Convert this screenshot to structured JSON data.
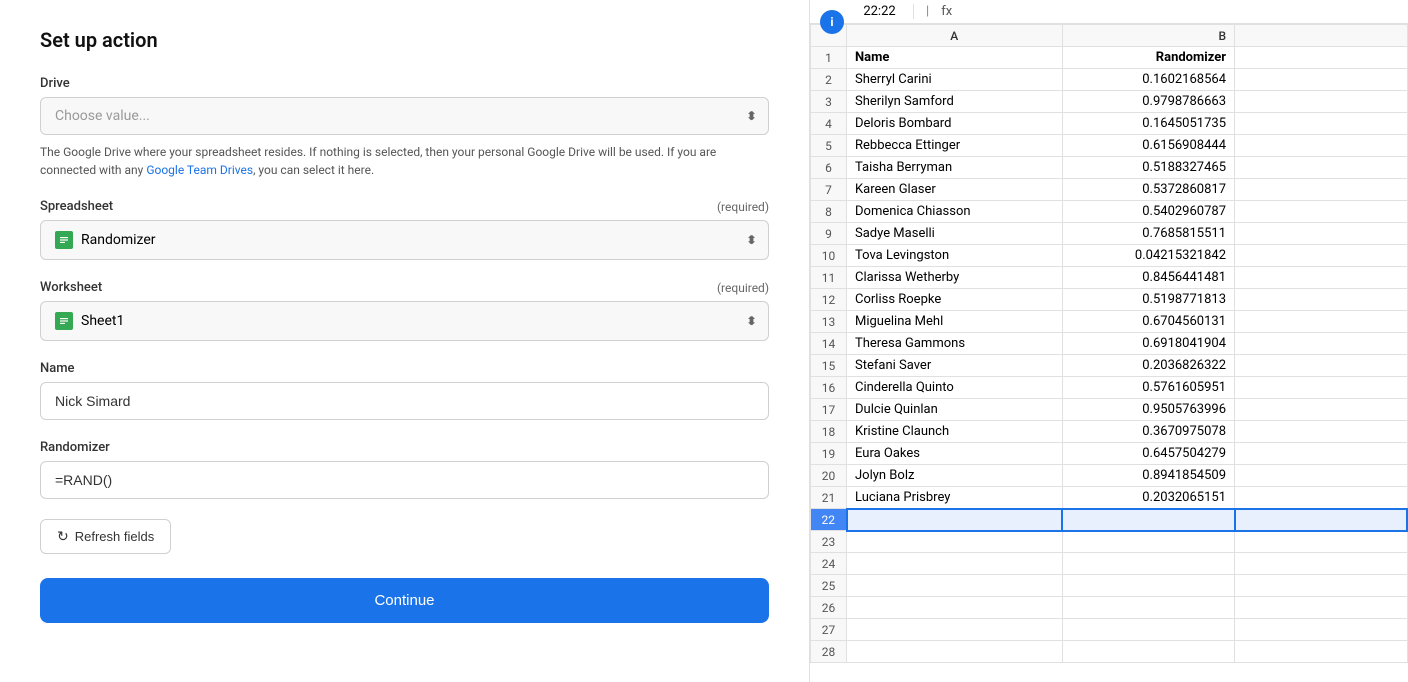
{
  "leftPanel": {
    "title": "Set up action",
    "drive": {
      "label": "Drive",
      "placeholder": "Choose value...",
      "helperText": "The Google Drive where your spreadsheet resides. If nothing is selected, then your personal Google Drive will be used. If you are connected with any ",
      "helperLinkText": "Google Team Drives",
      "helperTextEnd": ", you can select it here."
    },
    "spreadsheet": {
      "label": "Spreadsheet",
      "required": "(required)",
      "value": "Randomizer"
    },
    "worksheet": {
      "label": "Worksheet",
      "required": "(required)",
      "value": "Sheet1"
    },
    "name": {
      "label": "Name",
      "value": "Nick Simard"
    },
    "randomizer": {
      "label": "Randomizer",
      "value": "=RAND()"
    },
    "refreshButton": "Refresh fields",
    "continueButton": "Continue"
  },
  "rightPanel": {
    "formulaBar": {
      "cellRef": "22:22",
      "formula": "fx"
    },
    "columns": [
      "",
      "A",
      "B"
    ],
    "headerRow": {
      "col1": "Name",
      "col2": "Randomizer"
    },
    "rows": [
      {
        "num": 2,
        "name": "Sherryl Carini",
        "value": "0.1602168564"
      },
      {
        "num": 3,
        "name": "Sherilyn Samford",
        "value": "0.9798786663"
      },
      {
        "num": 4,
        "name": "Deloris Bombard",
        "value": "0.1645051735"
      },
      {
        "num": 5,
        "name": "Rebbecca Ettinger",
        "value": "0.6156908444"
      },
      {
        "num": 6,
        "name": "Taisha Berryman",
        "value": "0.5188327465"
      },
      {
        "num": 7,
        "name": "Kareen Glaser",
        "value": "0.5372860817"
      },
      {
        "num": 8,
        "name": "Domenica Chiasson",
        "value": "0.5402960787"
      },
      {
        "num": 9,
        "name": "Sadye Maselli",
        "value": "0.7685815511"
      },
      {
        "num": 10,
        "name": "Tova Levingston",
        "value": "0.04215321842"
      },
      {
        "num": 11,
        "name": "Clarissa Wetherby",
        "value": "0.8456441481"
      },
      {
        "num": 12,
        "name": "Corliss Roepke",
        "value": "0.5198771813"
      },
      {
        "num": 13,
        "name": "Miguelina Mehl",
        "value": "0.6704560131"
      },
      {
        "num": 14,
        "name": "Theresa Gammons",
        "value": "0.6918041904"
      },
      {
        "num": 15,
        "name": "Stefani Saver",
        "value": "0.2036826322"
      },
      {
        "num": 16,
        "name": "Cinderella Quinto",
        "value": "0.5761605951"
      },
      {
        "num": 17,
        "name": "Dulcie Quinlan",
        "value": "0.9505763996"
      },
      {
        "num": 18,
        "name": "Kristine Claunch",
        "value": "0.3670975078"
      },
      {
        "num": 19,
        "name": "Eura Oakes",
        "value": "0.6457504279"
      },
      {
        "num": 20,
        "name": "Jolyn Bolz",
        "value": "0.8941854509"
      },
      {
        "num": 21,
        "name": "Luciana Prisbrey",
        "value": "0.2032065151"
      },
      {
        "num": 22,
        "name": "",
        "value": "",
        "selected": true
      },
      {
        "num": 23,
        "name": "",
        "value": ""
      },
      {
        "num": 24,
        "name": "",
        "value": ""
      },
      {
        "num": 25,
        "name": "",
        "value": ""
      },
      {
        "num": 26,
        "name": "",
        "value": ""
      },
      {
        "num": 27,
        "name": "",
        "value": ""
      },
      {
        "num": 28,
        "name": "",
        "value": ""
      }
    ]
  }
}
